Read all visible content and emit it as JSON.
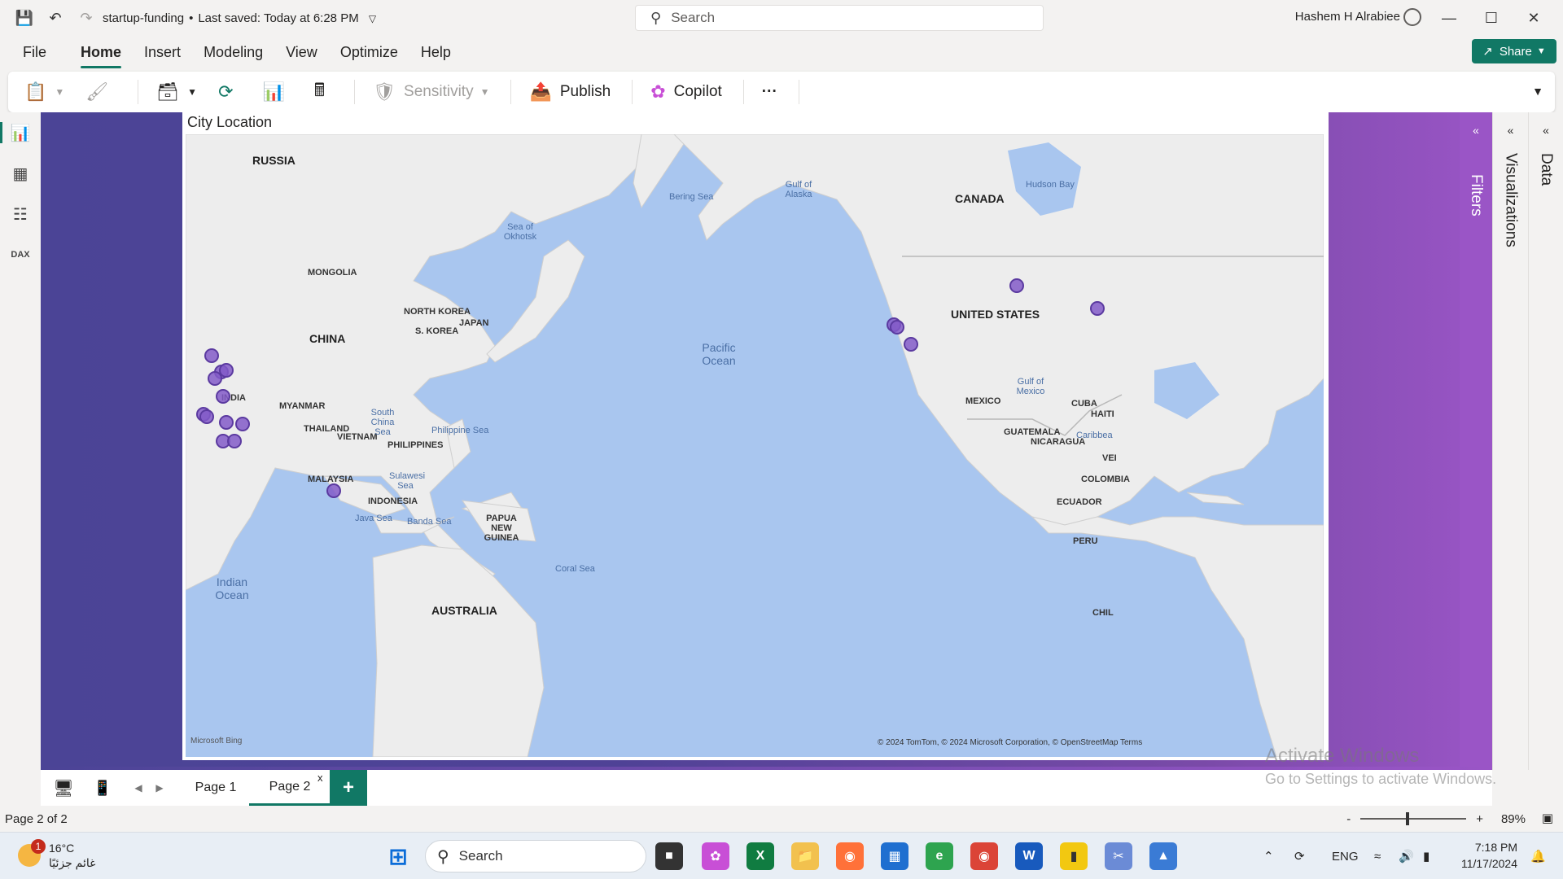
{
  "titlebar": {
    "doc_name": "startup-funding",
    "separator": "•",
    "saved_status": "Last saved: Today at 6:28 PM",
    "search_placeholder": "Search",
    "user_name": "Hashem H Alrabiee"
  },
  "menu": {
    "items": [
      "File",
      "Home",
      "Insert",
      "Modeling",
      "View",
      "Optimize",
      "Help"
    ],
    "active": "Home",
    "share_label": "Share"
  },
  "ribbon": {
    "sensitivity_label": "Sensitivity",
    "publish_label": "Publish",
    "copilot_label": "Copilot",
    "more_label": "···"
  },
  "visual": {
    "title": "City Location",
    "map_labels": {
      "russia": "RUSSIA",
      "mongolia": "MONGOLIA",
      "china": "CHINA",
      "north_korea": "NORTH KOREA",
      "south_korea": "S. KOREA",
      "japan": "JAPAN",
      "india": "INDIA",
      "myanmar": "MYANMAR",
      "thailand": "THAILAND",
      "vietnam": "VIETNAM",
      "philippines": "PHILIPPINES",
      "malaysia": "MALAYSIA",
      "indonesia": "INDONESIA",
      "papua": "PAPUA NEW GUINEA",
      "australia": "AUSTRALIA",
      "canada": "CANADA",
      "united_states": "UNITED STATES",
      "mexico": "MEXICO",
      "cuba": "CUBA",
      "haiti": "HAITI",
      "guatemala": "GUATEMALA",
      "nicaragua": "NICARAGUA",
      "colombia": "COLOMBIA",
      "ecuador": "ECUADOR",
      "peru": "PERU",
      "chile": "CHIL",
      "venezuela": "VEI",
      "bering_sea": "Bering Sea",
      "gulf_alaska": "Gulf of Alaska",
      "hudson_bay": "Hudson Bay",
      "sea_okhotsk": "Sea of Okhotsk",
      "south_china_sea": "South China Sea",
      "philippine_sea": "Philippine Sea",
      "sulawesi_sea": "Sulawesi Sea",
      "java_sea": "Java Sea",
      "banda_sea": "Banda Sea",
      "coral_sea": "Coral Sea",
      "gulf_mexico": "Gulf of Mexico",
      "caribbean": "Caribbea",
      "pacific_ocean": "Pacific Ocean",
      "indian_ocean": "Indian Ocean"
    },
    "attribution": "© 2024 TomTom, © 2024 Microsoft Corporation, © OpenStreetMap  Terms",
    "bing_logo": "Microsoft Bing"
  },
  "panes": {
    "filters": "Filters",
    "visualizations": "Visualizations",
    "data": "Data"
  },
  "pages": {
    "tabs": [
      "Page 1",
      "Page 2"
    ],
    "active": "Page 2",
    "close_glyph": "x",
    "add_glyph": "+"
  },
  "status": {
    "page_indicator": "Page 2 of 2",
    "zoom_value": "89%",
    "zoom_minus": "-",
    "zoom_plus": "+"
  },
  "watermark": {
    "line1": "Activate Windows",
    "line2": "Go to Settings to activate Windows."
  },
  "taskbar": {
    "weather_temp": "16°C",
    "weather_desc": "غائم جزئيًا",
    "weather_badge": "1",
    "search_label": "Search",
    "language": "ENG",
    "time": "7:18 PM",
    "date": "11/17/2024"
  },
  "colors": {
    "accent": "#117865",
    "canvas_left": "#4b4496",
    "canvas_right": "#9a55c6",
    "bubble": "#825ac8"
  },
  "icons": [
    "save-icon",
    "undo-icon",
    "redo-icon",
    "search-icon",
    "user-icon",
    "minimize-icon",
    "maximize-icon",
    "close-icon",
    "share-icon",
    "paste-icon",
    "format-painter-icon",
    "get-data-icon",
    "refresh-icon",
    "new-visual-icon",
    "calculator-icon",
    "sensitivity-icon",
    "publish-icon",
    "copilot-icon",
    "report-view-icon",
    "table-view-icon",
    "model-view-icon",
    "dax-query-icon",
    "desktop-layout-icon",
    "mobile-layout-icon",
    "fit-page-icon"
  ]
}
